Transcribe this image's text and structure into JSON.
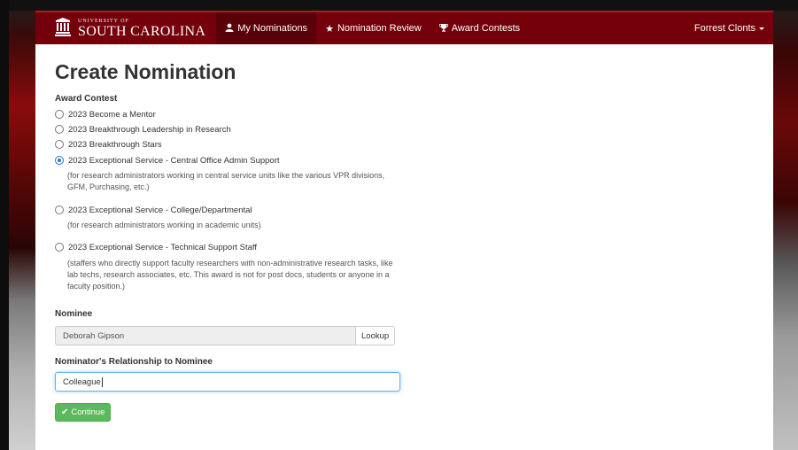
{
  "brand": {
    "line1": "UNIVERSITY OF",
    "line2": "SOUTH CAROLINA",
    "logo_icon": "university-seal-icon"
  },
  "nav": {
    "items": [
      {
        "label": "My Nominations",
        "icon": "user-icon",
        "active": true
      },
      {
        "label": "Nomination Review",
        "icon": "star-icon",
        "active": false
      },
      {
        "label": "Award Contests",
        "icon": "trophy-icon",
        "active": false
      }
    ],
    "user_label": "Forrest Clonts"
  },
  "page": {
    "title": "Create Nomination",
    "award_contest_label": "Award Contest",
    "options": [
      {
        "label": "2023 Become a Mentor",
        "checked": false,
        "desc": ""
      },
      {
        "label": "2023 Breakthrough Leadership in Research",
        "checked": false,
        "desc": ""
      },
      {
        "label": "2023 Breakthrough Stars",
        "checked": false,
        "desc": ""
      },
      {
        "label": "2023 Exceptional Service - Central Office Admin Support",
        "checked": true,
        "desc": "(for research administrators working in central service units like the various VPR divisions, GFM, Purchasing, etc.)"
      },
      {
        "label": "2023 Exceptional Service - College/Departmental",
        "checked": false,
        "desc": "(for research administrators working in academic units)"
      },
      {
        "label": "2023 Exceptional Service - Technical Support Staff",
        "checked": false,
        "desc": "(staffers who directly support faculty researchers with non-administrative research tasks, like lab techs, research associates, etc. This award is not for post docs, students or anyone in a faculty position.)"
      }
    ],
    "nominee_label": "Nominee",
    "nominee_value": "Deborah Gipson",
    "lookup_label": "Lookup",
    "relationship_label": "Nominator's Relationship to Nominee",
    "relationship_value": "Colleague",
    "continue_label": "Continue"
  },
  "colors": {
    "navbar": "#73000a",
    "success": "#5cb85c",
    "radio_accent": "#2a73d6"
  }
}
